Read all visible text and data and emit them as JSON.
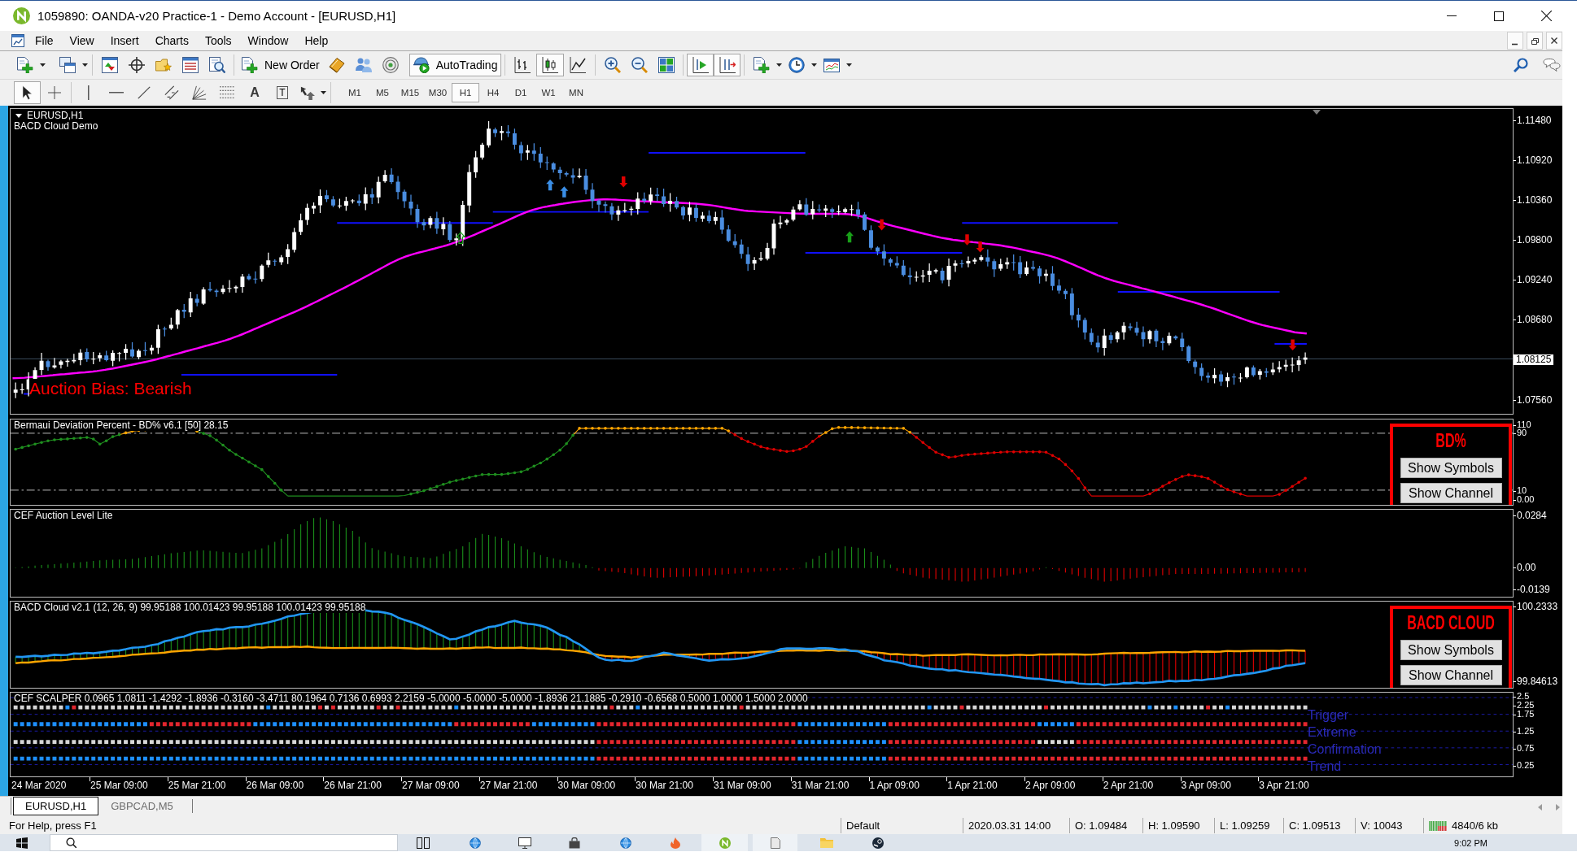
{
  "window": {
    "title": "1059890: OANDA-v20 Practice-1 - Demo Account - [EURUSD,H1]"
  },
  "menu": [
    "File",
    "View",
    "Insert",
    "Charts",
    "Tools",
    "Window",
    "Help"
  ],
  "toolbar": {
    "new_order": "New Order",
    "autotrading": {
      "label": "AutoTrading",
      "on": true
    },
    "chart_types": [
      {
        "kind": "bars",
        "selected": false
      },
      {
        "kind": "candles",
        "selected": true
      },
      {
        "kind": "line",
        "selected": false
      }
    ],
    "chart_options": [
      {
        "kind": "auto-scroll",
        "on": true
      },
      {
        "kind": "chart-shift",
        "on": true
      }
    ]
  },
  "drawing_toolbar": {
    "tools": [
      {
        "kind": "cursor",
        "selected": true
      },
      {
        "kind": "crosshair",
        "selected": false
      },
      {
        "kind": "vertical-line",
        "selected": false
      },
      {
        "kind": "horizontal-line",
        "selected": false
      },
      {
        "kind": "trend-line",
        "selected": false
      },
      {
        "kind": "channel",
        "selected": false
      },
      {
        "kind": "fan",
        "selected": false
      },
      {
        "kind": "fibonacci",
        "selected": false
      },
      {
        "kind": "text",
        "label": "A",
        "selected": false
      },
      {
        "kind": "text-label",
        "label": "T",
        "selected": false
      },
      {
        "kind": "arrows",
        "selected": false
      }
    ],
    "periods": [
      {
        "label": "M1",
        "selected": false
      },
      {
        "label": "M5",
        "selected": false
      },
      {
        "label": "M15",
        "selected": false
      },
      {
        "label": "M30",
        "selected": false
      },
      {
        "label": "H1",
        "selected": true
      },
      {
        "label": "H4",
        "selected": false
      },
      {
        "label": "D1",
        "selected": false
      },
      {
        "label": "W1",
        "selected": false
      },
      {
        "label": "MN",
        "selected": false
      }
    ]
  },
  "chart": {
    "symbol": "EURUSD,H1",
    "name": "BACD Cloud Demo",
    "bias": "Auction Bias: Bearish",
    "price_axis": [
      {
        "label": "1.11480",
        "current": false
      },
      {
        "label": "1.10920",
        "current": false
      },
      {
        "label": "1.10360",
        "current": false
      },
      {
        "label": "1.09800",
        "current": false
      },
      {
        "label": "1.09240",
        "current": false
      },
      {
        "label": "1.08680",
        "current": false
      },
      {
        "label": "1.08125",
        "current": true
      },
      {
        "label": "1.07560",
        "current": false
      }
    ],
    "indicators": [
      {
        "kind": "bd-percent",
        "title": "Bermaui Deviation Percent - BD% v6.1 [50] 28.15",
        "axis": [
          "110",
          "90",
          "10",
          "0.00"
        ],
        "panel": {
          "title": "BD%",
          "buttons": [
            "Show Symbols",
            "Show Channel"
          ]
        }
      },
      {
        "kind": "auction-level",
        "title": "CEF Auction Level Lite",
        "axis": [
          "0.0284",
          "0.00",
          "-0.0139"
        ]
      },
      {
        "kind": "bacd-cloud",
        "title": "BACD Cloud v2.1 (12, 26, 9) 99.95188 100.01423 99.95188 100.01423 99.95188",
        "axis": [
          "100.2333",
          "99.84613"
        ],
        "panel": {
          "title": "BACD CLOUD",
          "buttons": [
            "Show Symbols",
            "Show Channel"
          ]
        }
      },
      {
        "kind": "scalper",
        "title": "CEF SCALPER 0.0965 1.0811 -1.4292 -1.8936 -0.3160 -3.4711 80.1964 0.7136 0.6993 2.2159 -5.0000 -5.0000 -5.0000 -1.8936 21.1885 -0.2910 -0.6568 0.5000 1.0000 1.5000 2.0000",
        "axis": [
          "2.5",
          "2.25",
          "1.75",
          "1.25",
          "0.75",
          "0.25"
        ],
        "row_labels": [
          "Trigger",
          "Extreme",
          "Confirmation",
          "Trend"
        ]
      }
    ],
    "time_axis": [
      "24 Mar 2020",
      "25 Mar 09:00",
      "25 Mar 21:00",
      "26 Mar 09:00",
      "26 Mar 21:00",
      "27 Mar 09:00",
      "27 Mar 21:00",
      "30 Mar 09:00",
      "30 Mar 21:00",
      "31 Mar 09:00",
      "31 Mar 21:00",
      "1 Apr 09:00",
      "1 Apr 21:00",
      "2 Apr 09:00",
      "2 Apr 21:00",
      "3 Apr 09:00",
      "3 Apr 21:00"
    ]
  },
  "chart_tabs": [
    {
      "label": "EURUSD,H1",
      "selected": true
    },
    {
      "label": "GBPCAD,M5",
      "selected": false
    }
  ],
  "status_bar": {
    "help": "For Help, press F1",
    "profile": "Default",
    "bar_time": "2020.03.31 14:00",
    "open": "O: 1.09484",
    "high": "H: 1.09590",
    "low": "L: 1.09259",
    "close": "C: 1.09513",
    "volume": "V: 10043",
    "traffic": "4840/6 kb"
  },
  "taskbar": {
    "clock": "9:02 PM"
  }
}
